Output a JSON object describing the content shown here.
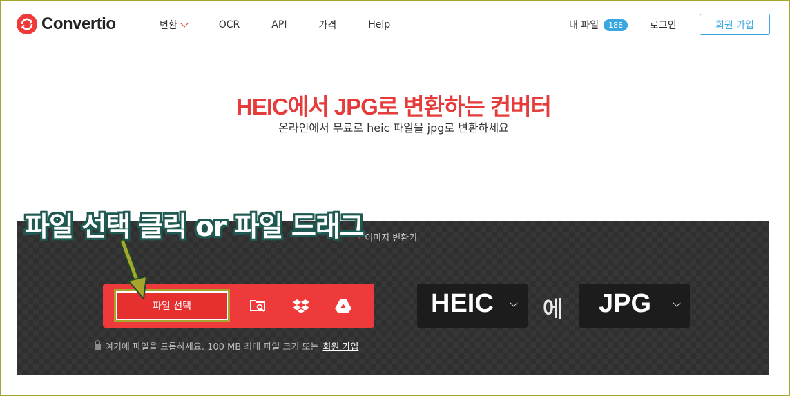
{
  "header": {
    "logo_text": "Convertio",
    "nav": [
      {
        "label": "변환"
      },
      {
        "label": "OCR"
      },
      {
        "label": "API"
      },
      {
        "label": "가격"
      },
      {
        "label": "Help"
      }
    ],
    "my_files_label": "내 파일",
    "my_files_count": "188",
    "login_label": "로그인",
    "signup_label": "회원 가입"
  },
  "hero": {
    "title": "HEIC에서 JPG로 변환하는 컨버터",
    "subtitle": "온라인에서 무료로 heic 파일을 jpg로 변환하세요"
  },
  "converter": {
    "breadcrumb": "이미지 변환기",
    "choose_file_label": "파일 선택",
    "drop_note": "여기에 파일을 드롭하세요. 100 MB 최대 파일 크기 또는",
    "drop_note_link": "회원 가입",
    "from_format": "HEIC",
    "to_word": "에",
    "to_format": "JPG"
  },
  "annotation": {
    "text": "파일 선택 클릭 or 파일 드래그"
  },
  "colors": {
    "accent": "#ee3a3a",
    "link_blue": "#3aa7e0",
    "annotation_border": "#a8a52e"
  },
  "icons": {
    "logo": "convertio-refresh-icon",
    "dropdown": "chevron-down-icon",
    "folder": "folder-search-icon",
    "dropbox": "dropbox-icon",
    "drive": "google-drive-icon",
    "lock": "lock-icon"
  }
}
